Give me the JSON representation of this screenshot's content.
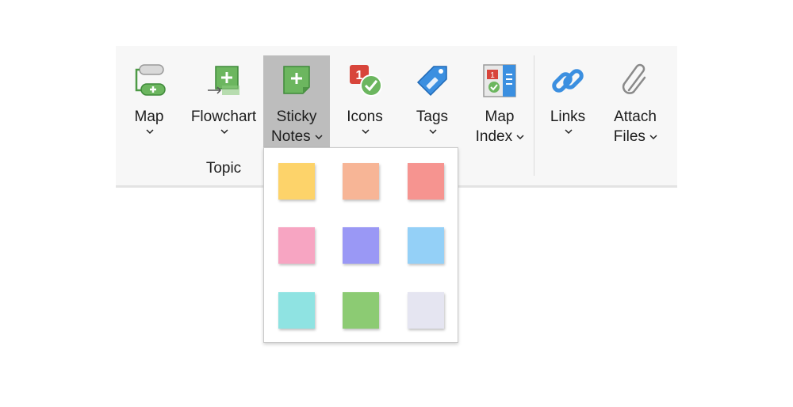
{
  "ribbon": {
    "buttons": [
      {
        "id": "map",
        "label1": "Map",
        "label2": "",
        "icon": "map-icon"
      },
      {
        "id": "flowchart",
        "label1": "Flowchart",
        "label2": "",
        "icon": "flowchart-icon"
      },
      {
        "id": "sticky",
        "label1": "Sticky",
        "label2": "Notes",
        "icon": "sticky-note-icon",
        "active": true
      },
      {
        "id": "icons",
        "label1": "Icons",
        "label2": "",
        "icon": "icons-icon"
      },
      {
        "id": "tags",
        "label1": "Tags",
        "label2": "",
        "icon": "tag-icon"
      },
      {
        "id": "mapindex",
        "label1": "Map",
        "label2": "Index",
        "icon": "map-index-icon"
      },
      {
        "id": "links",
        "label1": "Links",
        "label2": "",
        "icon": "link-icon"
      },
      {
        "id": "attach",
        "label1": "Attach",
        "label2": "Files",
        "icon": "paperclip-icon"
      }
    ],
    "group_label": "Topic"
  },
  "sticky_menu": {
    "colors": [
      "#FDD36A",
      "#F7B596",
      "#F69490",
      "#F7A5C2",
      "#9A98F5",
      "#94D0F7",
      "#8FE3E2",
      "#8CCB73",
      "#E5E5F1"
    ]
  },
  "theme": {
    "active_bg": "#BDBDBD",
    "green": "#6CB65F",
    "blue": "#3B8FE0"
  }
}
